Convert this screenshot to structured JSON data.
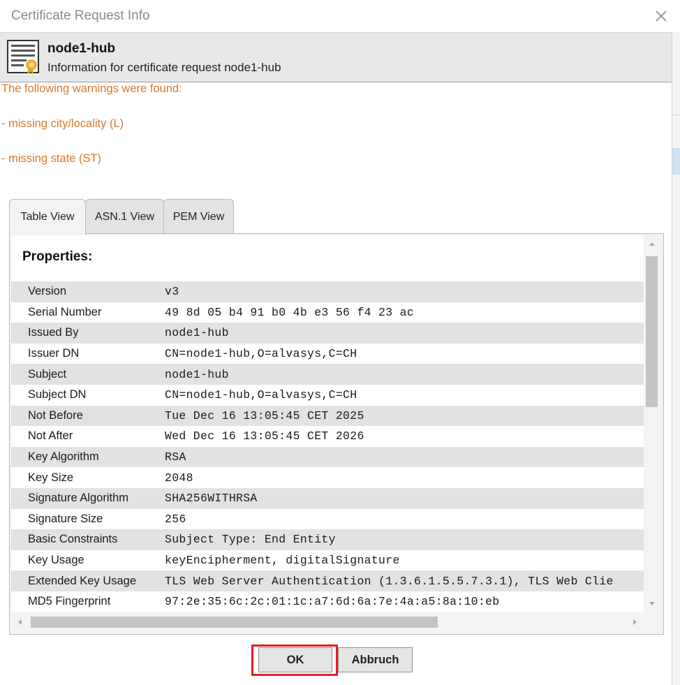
{
  "window": {
    "title": "Certificate Request Info"
  },
  "header": {
    "title": "node1-hub",
    "subtitle": "Information for certificate request node1-hub"
  },
  "warnings": {
    "heading": "The following warnings were found:",
    "items": [
      "- missing city/locality  (L)",
      "- missing state (ST)"
    ]
  },
  "tabs": [
    {
      "label": "Table View",
      "active": true
    },
    {
      "label": "ASN.1 View",
      "active": false
    },
    {
      "label": "PEM View",
      "active": false
    }
  ],
  "properties": {
    "heading": "Properties:",
    "rows": [
      {
        "name": "Version",
        "value": "v3"
      },
      {
        "name": "Serial Number",
        "value": "49 8d 05 b4 91 b0 4b e3 56 f4 23 ac"
      },
      {
        "name": "Issued By",
        "value": "node1-hub"
      },
      {
        "name": "Issuer DN",
        "value": "CN=node1-hub,O=alvasys,C=CH"
      },
      {
        "name": "Subject",
        "value": "node1-hub"
      },
      {
        "name": "Subject DN",
        "value": "CN=node1-hub,O=alvasys,C=CH"
      },
      {
        "name": "Not Before",
        "value": "Tue Dec 16 13:05:45 CET 2025"
      },
      {
        "name": "Not After",
        "value": "Wed Dec 16 13:05:45 CET 2026"
      },
      {
        "name": "Key Algorithm",
        "value": "RSA"
      },
      {
        "name": "Key Size",
        "value": "2048"
      },
      {
        "name": "Signature Algorithm",
        "value": "SHA256WITHRSA"
      },
      {
        "name": "Signature Size",
        "value": "256"
      },
      {
        "name": "Basic Constraints",
        "value": "Subject Type: End Entity"
      },
      {
        "name": "Key Usage",
        "value": "keyEncipherment, digitalSignature"
      },
      {
        "name": "Extended Key Usage",
        "value": "TLS Web Server Authentication (1.3.6.1.5.5.7.3.1), TLS Web Clie"
      },
      {
        "name": "MD5 Fingerprint",
        "value": "97:2e:35:6c:2c:01:1c:a7:6d:6a:7e:4a:a5:8a:10:eb"
      }
    ]
  },
  "buttons": {
    "ok": "OK",
    "cancel": "Abbruch"
  },
  "colors": {
    "warning_text": "#d9782b",
    "highlight_box": "#e01f26",
    "row_stripe": "#e2e2e2"
  },
  "icons": {
    "close": "close-icon",
    "certificate": "certificate-icon"
  }
}
